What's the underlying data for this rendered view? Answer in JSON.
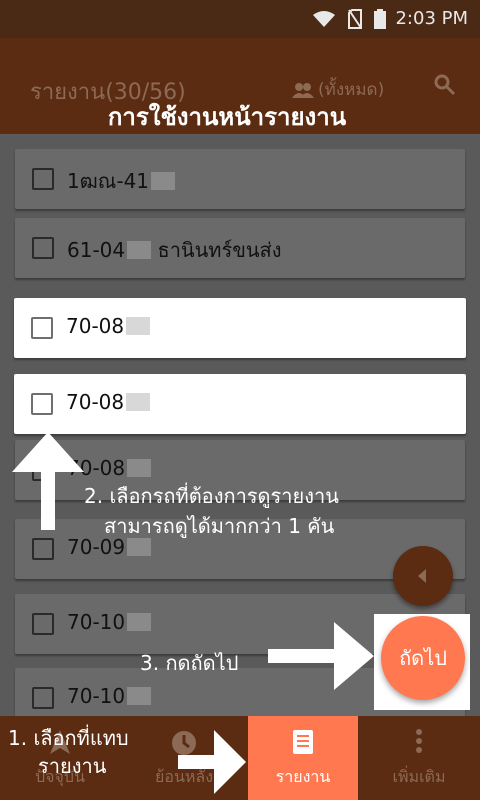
{
  "status_bar": {
    "time": "2:03 PM",
    "icons": [
      "wifi-icon",
      "no-sim-icon",
      "battery-icon"
    ]
  },
  "app_bar": {
    "title": "รายงาน(30/56)",
    "filter_label": "(ทั้งหมด)",
    "filter_icon": "group-icon",
    "search_icon": "search-icon"
  },
  "overlay": {
    "title": "การใช้งานหน้ารายงาน"
  },
  "list": {
    "items": [
      {
        "label": "1ฒณ-41",
        "highlighted": false
      },
      {
        "label": "61-04",
        "suffix": "ธานินทร์ขนส่ง",
        "highlighted": false
      },
      {
        "label": "70-08",
        "highlighted": true
      },
      {
        "label": "70-08",
        "highlighted": true
      },
      {
        "label": "70-08",
        "highlighted": false
      },
      {
        "label": "70-09",
        "highlighted": false
      },
      {
        "label": "70-10",
        "highlighted": false
      },
      {
        "label": "70-10",
        "highlighted": false
      }
    ]
  },
  "fab": {
    "next_label": "ถัดไป",
    "back_icon": "chevron-left-icon"
  },
  "bottom_nav": {
    "items": [
      {
        "label": "ปัจจุบัน",
        "icon": "navigation-icon",
        "active": false
      },
      {
        "label": "ย้อนหลัง",
        "icon": "history-icon",
        "active": false
      },
      {
        "label": "รายงาน",
        "icon": "report-icon",
        "active": true
      },
      {
        "label": "เพิ่มเติม",
        "icon": "more-vert-icon",
        "active": false
      }
    ]
  },
  "annotations": {
    "step1_line1": "1. เลือกที่แทบ",
    "step1_line2": "รายงาน",
    "step2_line1": "2. เลือกรถที่ต้องการดูรายงาน",
    "step2_line2": "สามารถดูได้มากกว่า 1 คัน",
    "step3": "3. กดถัดไป"
  },
  "colors": {
    "brand_dark": "#5b2c12",
    "accent": "#ff7850",
    "overlay": "#5a5a5a"
  }
}
